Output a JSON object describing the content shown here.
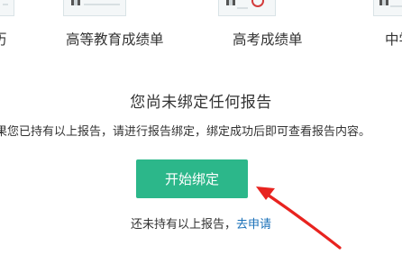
{
  "report_types": [
    {
      "label": "历"
    },
    {
      "label": "高等教育成绩单"
    },
    {
      "label": "高考成绩单"
    },
    {
      "label": "中学"
    }
  ],
  "empty_state": {
    "headline": "您尚未绑定任何报告",
    "description": "果您已持有以上报告，请进行报告绑定，绑定成功后即可查看报告内容。",
    "start_button_label": "开始绑定",
    "hint_text": "还未持有以上报告，",
    "apply_link_label": "去申请"
  },
  "colors": {
    "primary_button": "#2cb78a",
    "link": "#1a70b8",
    "annotation_arrow": "#e8231f"
  }
}
